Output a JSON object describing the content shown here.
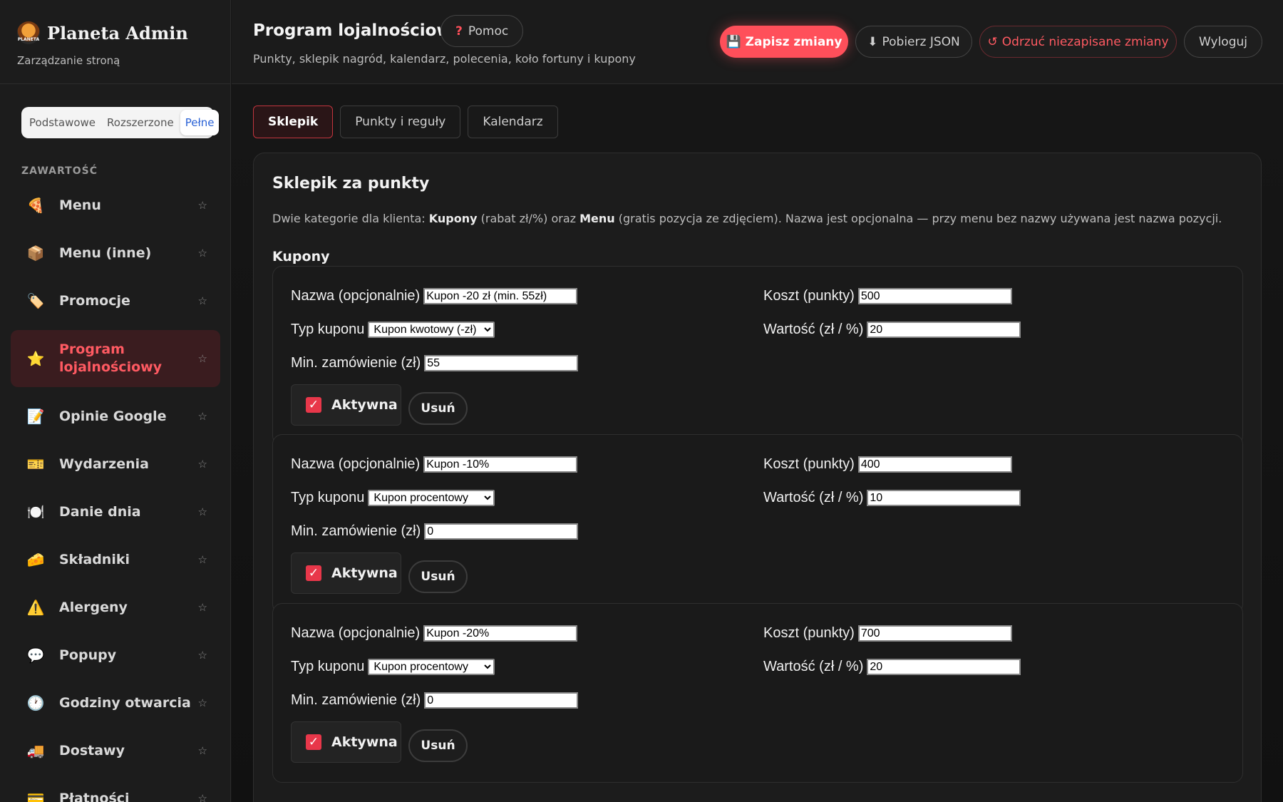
{
  "brand": {
    "logo_text": "PLANETA",
    "title": "Planeta Admin",
    "subtitle": "Zarządzanie stroną"
  },
  "levels": [
    {
      "label": "Podstawowe",
      "active": false
    },
    {
      "label": "Rozszerzone",
      "active": false
    },
    {
      "label": "Pełne",
      "active": true
    }
  ],
  "sidebar": {
    "section_label": "ZAWARTOŚĆ",
    "items": [
      {
        "label": "Menu",
        "icon": "🍕",
        "name": "pizza-icon"
      },
      {
        "label": "Menu (inne)",
        "icon": "📦",
        "name": "package-icon"
      },
      {
        "label": "Promocje",
        "icon": "🏷️",
        "name": "tag-icon"
      },
      {
        "label": "Program lojalnościowy",
        "icon": "⭐",
        "name": "star-icon",
        "active": true
      },
      {
        "label": "Opinie Google",
        "icon": "📝",
        "name": "memo-icon"
      },
      {
        "label": "Wydarzenia",
        "icon": "🎫",
        "name": "ticket-icon"
      },
      {
        "label": "Danie dnia",
        "icon": "🍽️",
        "name": "plate-icon"
      },
      {
        "label": "Składniki",
        "icon": "🧀",
        "name": "cheese-icon"
      },
      {
        "label": "Alergeny",
        "icon": "⚠️",
        "name": "warning-icon"
      },
      {
        "label": "Popupy",
        "icon": "💬",
        "name": "speech-bubble-icon"
      },
      {
        "label": "Godziny otwarcia",
        "icon": "🕐",
        "name": "clock-icon"
      },
      {
        "label": "Dostawy",
        "icon": "🚚",
        "name": "truck-icon"
      },
      {
        "label": "Płatności",
        "icon": "💳",
        "name": "card-icon"
      }
    ],
    "favorite_glyph": "☆"
  },
  "header": {
    "title": "Program lojalnościowy",
    "help_icon": "?",
    "help_label": "Pomoc",
    "subtitle": "Punkty, sklepik nagród, kalendarz, polecenia, koło fortuny i kupony",
    "save_icon": "💾",
    "save_label": "Zapisz zmiany",
    "json_icon": "⬇",
    "json_label": "Pobierz JSON",
    "revert_icon": "↺",
    "revert_label": "Odrzuć niezapisane zmiany",
    "logout_label": "Wyloguj"
  },
  "tabs": [
    {
      "label": "Sklepik",
      "active": true
    },
    {
      "label": "Punkty i reguły",
      "active": false
    },
    {
      "label": "Kalendarz",
      "active": false
    }
  ],
  "shop": {
    "title": "Sklepik za punkty",
    "desc_1": "Dwie kategorie dla klienta: ",
    "desc_b1": "Kupony",
    "desc_2": " (rabat zł/%) oraz ",
    "desc_b2": "Menu",
    "desc_3": " (gratis pozycja ze zdjęciem). Nazwa jest opcjonalna — przy menu bez nazwy używana jest nazwa pozycji.",
    "coupons_title": "Kupony",
    "labels": {
      "name": "Nazwa (opcjonalnie)",
      "type": "Typ kuponu",
      "min": "Min. zamówienie (zł)",
      "cost": "Koszt (punkty)",
      "value": "Wartość (zł / %)",
      "active": "Aktywna",
      "remove": "Usuń"
    },
    "coupons": [
      {
        "name": "Kupon -20 zł (min. 55zł)",
        "type": "Kupon kwotowy (-zł)",
        "min": "55",
        "cost": "500",
        "value": "20",
        "active": true
      },
      {
        "name": "Kupon -10%",
        "type": "Kupon procentowy",
        "min": "0",
        "cost": "400",
        "value": "10",
        "active": true
      },
      {
        "name": "Kupon -20%",
        "type": "Kupon procentowy",
        "min": "0",
        "cost": "700",
        "value": "20",
        "active": true
      }
    ]
  },
  "colors": {
    "accent": "#ff4f5a",
    "active_nav_bg": "#3a1c1f",
    "link_blue": "#2a62d6"
  }
}
